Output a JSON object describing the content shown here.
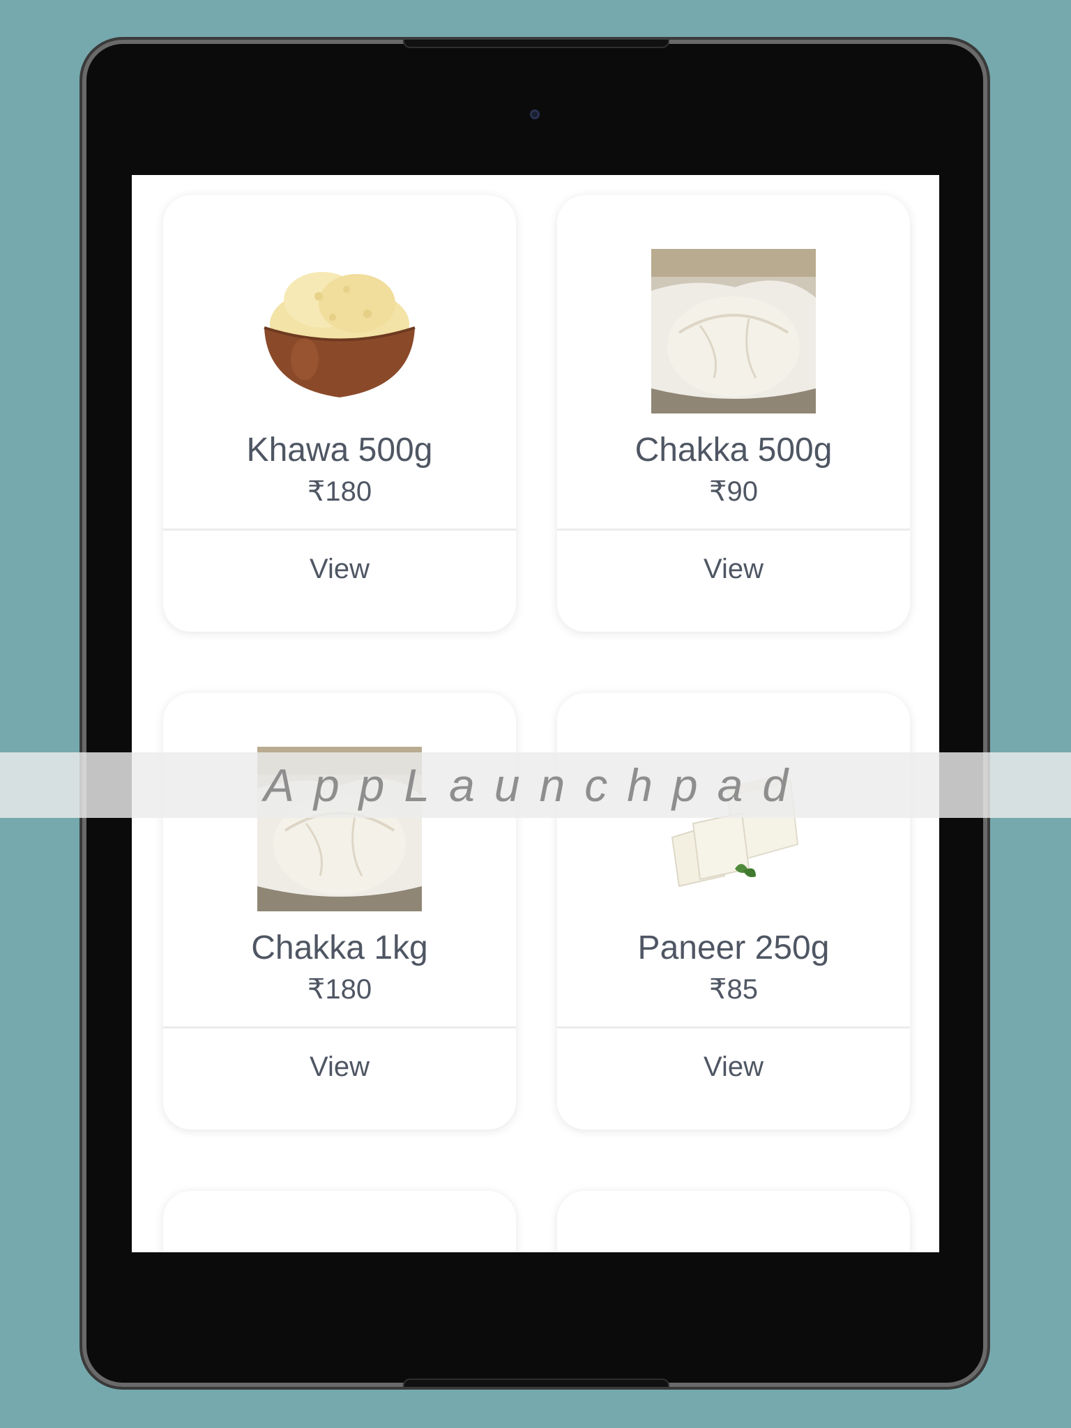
{
  "products": [
    {
      "name": "Khawa 500g",
      "price": "₹180",
      "action": "View"
    },
    {
      "name": "Chakka 500g",
      "price": "₹90",
      "action": "View"
    },
    {
      "name": "Chakka 1kg",
      "price": "₹180",
      "action": "View"
    },
    {
      "name": "Paneer 250g",
      "price": "₹85",
      "action": "View"
    }
  ],
  "watermark": "AppLaunchpad",
  "colors": {
    "background": "#76a9ad",
    "text": "#4f5663",
    "card": "#ffffff"
  }
}
